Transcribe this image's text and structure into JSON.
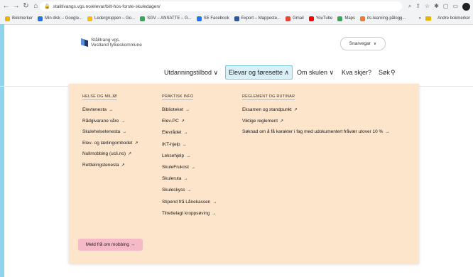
{
  "browser": {
    "url": "stalitivangs.vgs.no/elevar/bilt-hos-forste-skuledagen/",
    "back_icon": "arrow-left",
    "forward_icon": "arrow-right",
    "reload_icon": "reload",
    "home_icon": "home",
    "lock_icon": "lock"
  },
  "bookmarks": {
    "items": [
      {
        "label": "Bokmerker",
        "color": "#e8b400"
      },
      {
        "label": "Min disk – Google...",
        "color": "#1a73e8"
      },
      {
        "label": "Ledergruppen – Go...",
        "color": "#fbbc04"
      },
      {
        "label": "SGV – ANSATTE – G...",
        "color": "#34a853"
      },
      {
        "label": "SE Facebook",
        "color": "#1877f2"
      },
      {
        "label": "Export – Mappeste...",
        "color": "#2b579a"
      },
      {
        "label": "Gmail",
        "color": "#ea4335"
      },
      {
        "label": "YouTube",
        "color": "#ff0000"
      },
      {
        "label": "Maps",
        "color": "#34a853"
      },
      {
        "label": "its-learning-pålogg...",
        "color": "#f4772e"
      }
    ],
    "right_label": "Andre bokmerker"
  },
  "site": {
    "logo_line1": "Stålitrang vgs.",
    "logo_line2": "Vestland fylkeskommune",
    "shortcut_label": "Snarvegar",
    "nav": [
      {
        "label": "Utdanningstilbod ∨",
        "active": false
      },
      {
        "label": "Elevar og føresette ∧",
        "active": true
      },
      {
        "label": "Om skulen ∨",
        "active": false
      },
      {
        "label": "Kva skjer?",
        "active": false
      },
      {
        "label": "Søk",
        "active": false
      }
    ]
  },
  "menu": {
    "col1": {
      "title": "HELSE OG MILJØ",
      "links": [
        {
          "label": "Elevtenesta",
          "icon": "→"
        },
        {
          "label": "Rådgivarane våre",
          "icon": "→"
        },
        {
          "label": "Skulehelsetenesta",
          "icon": "→"
        },
        {
          "label": "Elev- og lærlingombodet",
          "icon": "↗"
        },
        {
          "label": "Nullmobbing (ucli.no)",
          "icon": "↗"
        },
        {
          "label": "Rettleiingstenesta",
          "icon": "↗"
        }
      ]
    },
    "col2": {
      "title": "PRAKTISK INFO",
      "links": [
        {
          "label": "Biblioteket",
          "icon": "→"
        },
        {
          "label": "Elev-PC",
          "icon": "↗"
        },
        {
          "label": "Elevrådet",
          "icon": "→"
        },
        {
          "label": "IKT-hjelp",
          "icon": "→"
        },
        {
          "label": "Leksehjelp",
          "icon": "→"
        },
        {
          "label": "SkuleFrukost",
          "icon": "→"
        },
        {
          "label": "Skuleruta",
          "icon": "→"
        },
        {
          "label": "Skuleskyss",
          "icon": "→"
        },
        {
          "label": "Stipend frå Lånekassen",
          "icon": "→"
        },
        {
          "label": "Tilrettelagt kroppsøving",
          "icon": "→"
        }
      ]
    },
    "col3": {
      "title": "REGLEMENT OG RUTINAR",
      "links": [
        {
          "label": "Eksamen og standpunkt",
          "icon": "↗"
        },
        {
          "label": "Viktige reglement",
          "icon": "↗"
        },
        {
          "label": "Søknad om å få karakter i fag med udokumentert fråvær utover 10 %",
          "icon": "→"
        }
      ]
    },
    "cta_label": "Meld frå om mobbing →"
  }
}
